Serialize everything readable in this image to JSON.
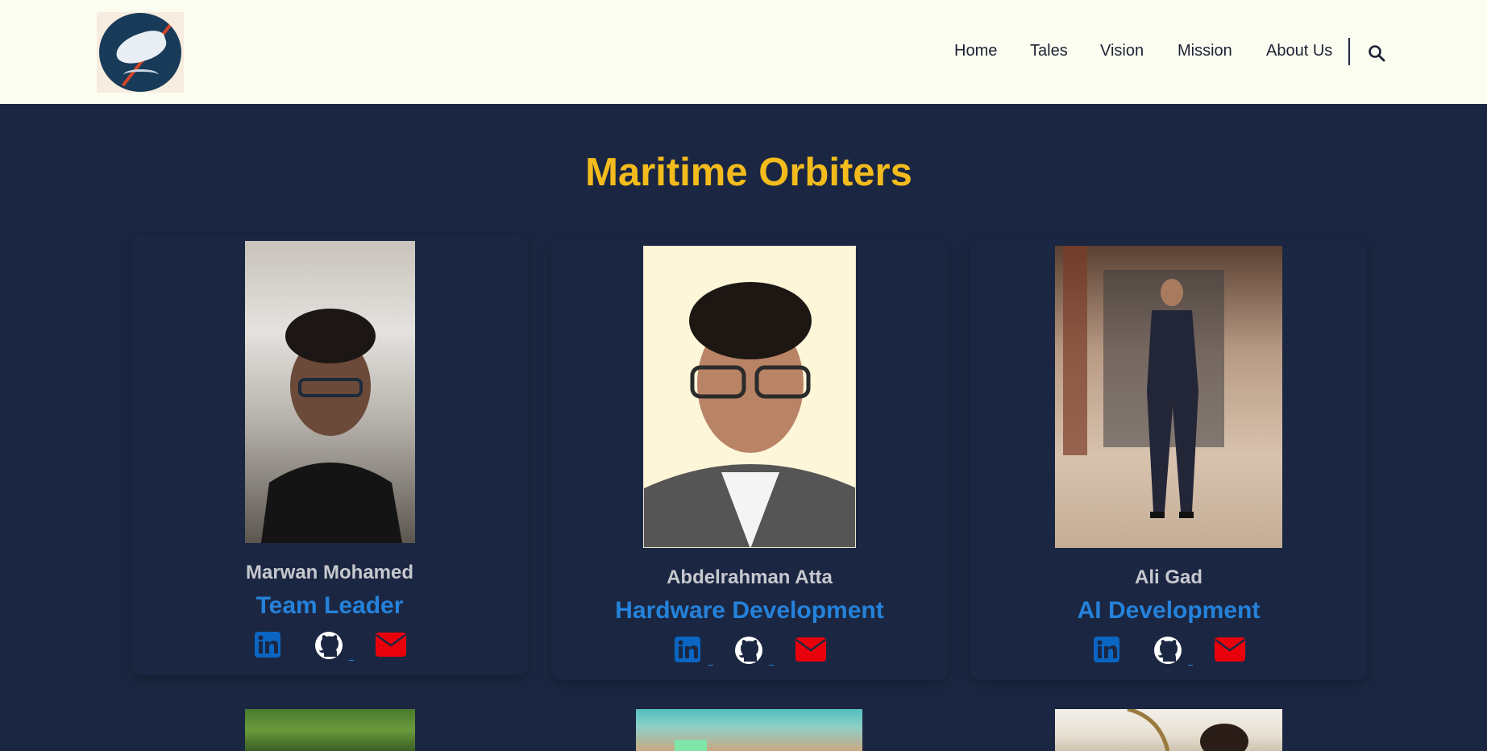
{
  "header": {
    "nav": [
      "Home",
      "Tales",
      "Vision",
      "Mission",
      "About Us"
    ]
  },
  "section": {
    "title": "Maritime Orbiters"
  },
  "team": [
    {
      "name": "Marwan Mohamed",
      "role": "Team Leader"
    },
    {
      "name": "Abdelrahman Atta",
      "role": "Hardware Development"
    },
    {
      "name": "Ali Gad",
      "role": "AI Development"
    }
  ],
  "colors": {
    "header_bg": "#fcfdf1",
    "page_bg": "#1b2742",
    "title": "#f3bc1c",
    "role": "#2582db",
    "name": "#c7c8cf",
    "linkedin": "#0a66c2",
    "github": "#ffffff",
    "email": "#e8000b"
  },
  "icons": [
    "linkedin-icon",
    "github-icon",
    "envelope-icon",
    "search-icon"
  ]
}
